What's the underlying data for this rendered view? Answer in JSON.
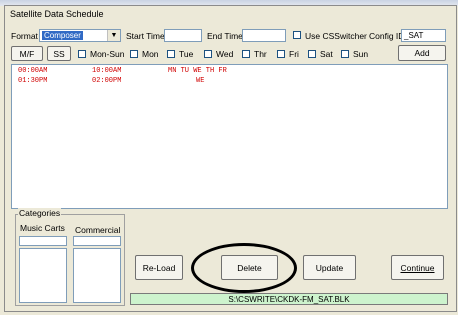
{
  "window": {
    "title": "Satellite Data Schedule"
  },
  "toolbar": {
    "format_label": "Format",
    "format_value": "Composer",
    "start_time_label": "Start Time:",
    "start_time_value": "",
    "end_time_label": "End Time",
    "end_time_value": "",
    "use_csswitcher_label": "Use CSSwitcher",
    "config_id_label": "Config ID",
    "config_id_value": "_SAT",
    "mf_label": "M/F",
    "ss_label": "SS",
    "days": [
      "Mon-Sun",
      "Mon",
      "Tue",
      "Wed",
      "Thr",
      "Fri",
      "Sat",
      "Sun"
    ],
    "add_label": "Add"
  },
  "schedule": {
    "rows": [
      {
        "start": "00:00AM",
        "end": "10:00AM",
        "days": "MN TU WE TH FR"
      },
      {
        "start": "01:30PM",
        "end": "02:00PM",
        "days": "WE"
      }
    ]
  },
  "categories": {
    "legend": "Categories",
    "music_label": "Music Carts",
    "commercial_label": "Commercial"
  },
  "actions": {
    "reload_label": "Re-Load",
    "delete_label": "Delete",
    "update_label": "Update",
    "continue_label": "Continue"
  },
  "status": {
    "path": "S:\\CSWRITE\\CKDK-FM_SAT.BLK"
  },
  "colors": {
    "schedule_text": "#d00000",
    "status_bg": "#cdf3cd",
    "highlight": "#316ac5"
  }
}
